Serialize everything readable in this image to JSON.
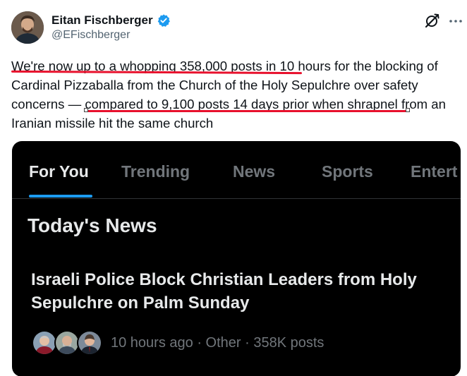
{
  "author": {
    "display_name": "Eitan Fischberger",
    "handle": "@EFischberger",
    "verified_color": "#1d9bf0"
  },
  "tweet": {
    "lines": [
      "We're now up to a whopping 358,000 posts in 10 hours for the blocking of",
      "Cardinal Pizzaballa from the Church of the Holy Sepulchre over safety",
      "concerns — compared to 9,100 posts 14 days prior when shrapnel from an",
      "Iranian missile hit the same church"
    ],
    "highlight_color": "#e8112d"
  },
  "icons": {
    "grok": "grok-icon",
    "more": "more-dots-icon",
    "verified": "verified-badge-icon"
  },
  "embed": {
    "tabs": [
      "For You",
      "Trending",
      "News",
      "Sports",
      "Entert"
    ],
    "active_tab": "For You",
    "accent_color": "#1d9bf0",
    "section_title": "Today's News",
    "headline_line1": "Israeli Police Block Christian Leaders from Holy",
    "headline_line2": "Sepulchre on Palm Sunday",
    "meta": "10 hours ago · Other · 358K posts"
  }
}
